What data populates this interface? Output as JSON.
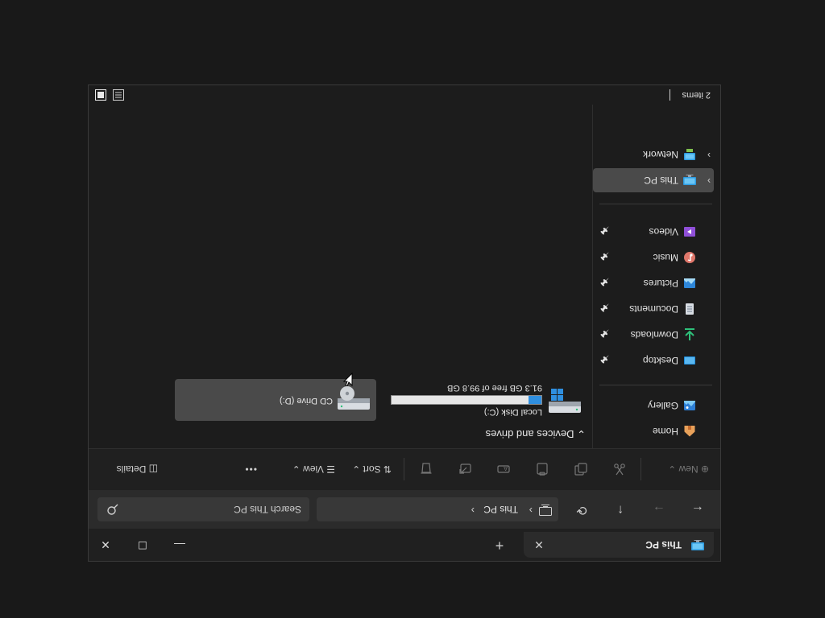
{
  "window": {
    "tab_title": "This PC",
    "new_tab_symbol": "+",
    "close_tab_symbol": "✕",
    "minimize_symbol": "—",
    "maximize_symbol": "☐",
    "close_symbol": "✕"
  },
  "address": {
    "path": "This PC",
    "search_placeholder": "Search This PC"
  },
  "commands": {
    "new_label": "New",
    "sort_label": "Sort",
    "view_label": "View",
    "more_symbol": "•••",
    "details_label": "Details"
  },
  "sidebar": {
    "home": "Home",
    "gallery": "Gallery",
    "pinned": [
      {
        "label": "Desktop",
        "icon": "desktop-folder-icon"
      },
      {
        "label": "Downloads",
        "icon": "download-icon"
      },
      {
        "label": "Documents",
        "icon": "documents-icon"
      },
      {
        "label": "Pictures",
        "icon": "pictures-icon"
      },
      {
        "label": "Music",
        "icon": "music-icon"
      },
      {
        "label": "Videos",
        "icon": "videos-icon"
      }
    ],
    "this_pc": "This PC",
    "network": "Network"
  },
  "content": {
    "group_title": "Devices and drives",
    "drives": [
      {
        "name": "Local Disk (C:)",
        "free_text": "91.3 GB free of 99.8 GB",
        "used_fraction": 0.085
      },
      {
        "name": "CD Drive (D:)"
      }
    ]
  },
  "status": {
    "item_count": "2 items"
  },
  "colors": {
    "accent": "#2f8fe0",
    "selection": "#4a4a4a",
    "background": "#1c1c1c"
  }
}
